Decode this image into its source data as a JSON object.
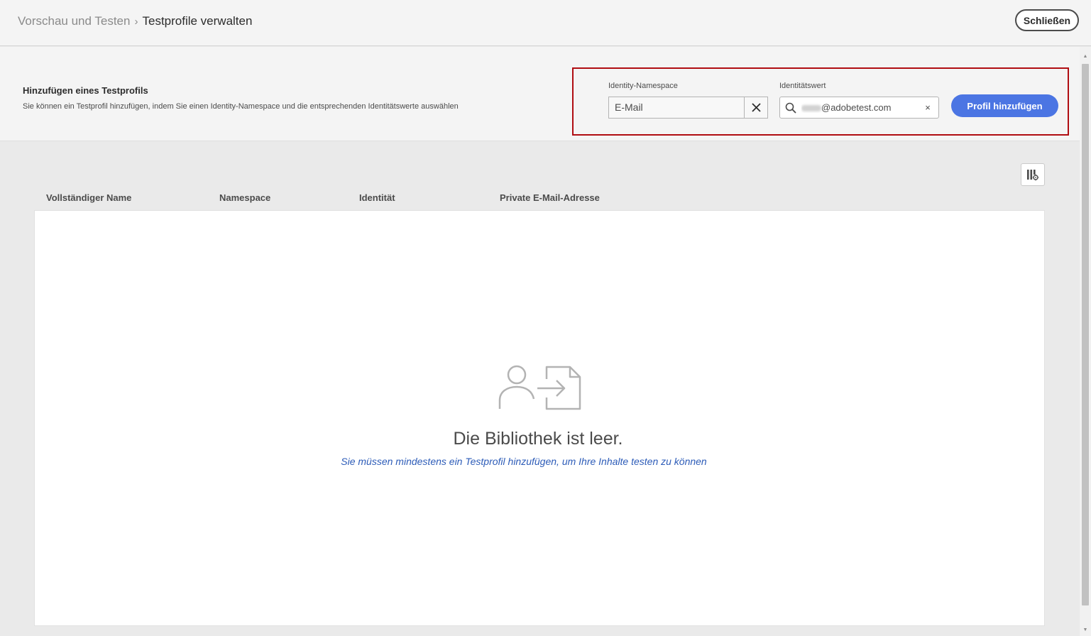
{
  "header": {
    "breadcrumb_parent": "Vorschau und Testen",
    "breadcrumb_separator": "›",
    "breadcrumb_current": "Testprofile verwalten",
    "close_label": "Schließen"
  },
  "add_profile": {
    "title": "Hinzufügen eines Testprofils",
    "description": "Sie können ein Testprofil hinzufügen, indem Sie einen Identity-Namespace und die entsprechenden Identitätswerte auswählen",
    "namespace_label": "Identity-Namespace",
    "namespace_value": "E-Mail",
    "identity_label": "Identitätswert",
    "identity_value": "@adobetest.com",
    "identity_clear": "×",
    "add_button_label": "Profil hinzufügen",
    "highlight_color": "#b00d12"
  },
  "table": {
    "columns": [
      "Vollständiger Name",
      "Namespace",
      "Identität",
      "Private E-Mail-Adresse"
    ]
  },
  "empty_state": {
    "title": "Die Bibliothek ist leer.",
    "message": "Sie müssen mindestens ein Testprofil hinzufügen, um Ihre Inhalte testen zu können"
  },
  "colors": {
    "primary_button": "#4b75e3",
    "link": "#2d5cb8"
  },
  "icons": {
    "namespace_clear": "close-icon",
    "identity_search": "search-icon",
    "column_settings": "column-settings-icon",
    "empty_state": "user-import-icon"
  }
}
